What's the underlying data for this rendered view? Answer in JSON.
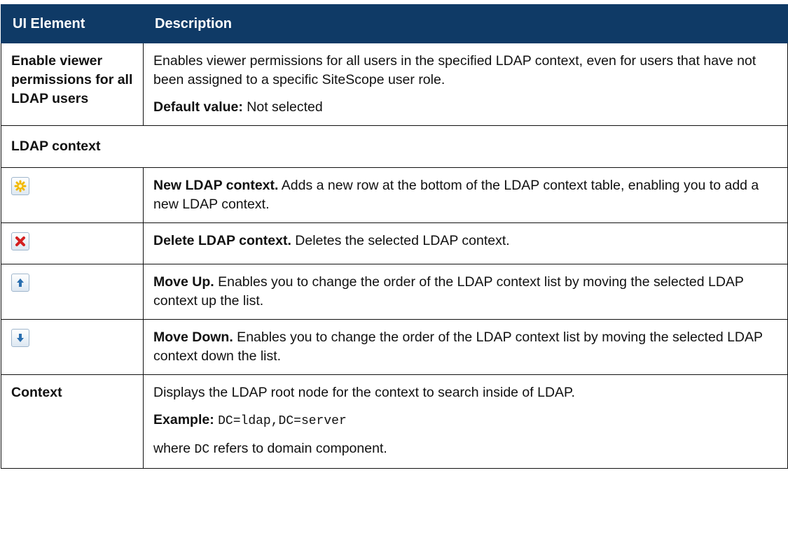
{
  "header": {
    "col_element": "UI Element",
    "col_description": "Description"
  },
  "viewer_row": {
    "element": "Enable viewer permissions for all LDAP users",
    "description": "Enables viewer permissions for all users in the specified LDAP context, even for users that have not been assigned to a specific SiteScope user role.",
    "default_label": "Default value:",
    "default_value": " Not selected"
  },
  "ldap_group": {
    "label": "LDAP context"
  },
  "rows": [
    {
      "icon": "new-star-icon",
      "title": "New LDAP context.",
      "text": " Adds a new row at the bottom of the LDAP context table, enabling you to add a new LDAP context."
    },
    {
      "icon": "delete-x-icon",
      "title": "Delete LDAP context.",
      "text": " Deletes the selected LDAP context."
    },
    {
      "icon": "move-up-arrow-icon",
      "title": "Move Up.",
      "text": " Enables you to change the order of the LDAP context list by moving the selected LDAP context up the list."
    },
    {
      "icon": "move-down-arrow-icon",
      "title": "Move Down.",
      "text": " Enables you to change the order of the LDAP context list by moving the selected LDAP context down the list."
    }
  ],
  "context_row": {
    "element": "Context",
    "description": "Displays the LDAP root node for the context to search inside of LDAP.",
    "example_label": "Example:",
    "example_code": "DC=ldap,DC=server",
    "where_prefix": "where ",
    "where_code": "DC",
    "where_suffix": " refers to domain component."
  },
  "colors": {
    "header_bg": "#0f3a66",
    "header_text": "#ffffff",
    "star": "#f2b800",
    "delete_x": "#d42020",
    "arrow": "#2a6fb0"
  }
}
